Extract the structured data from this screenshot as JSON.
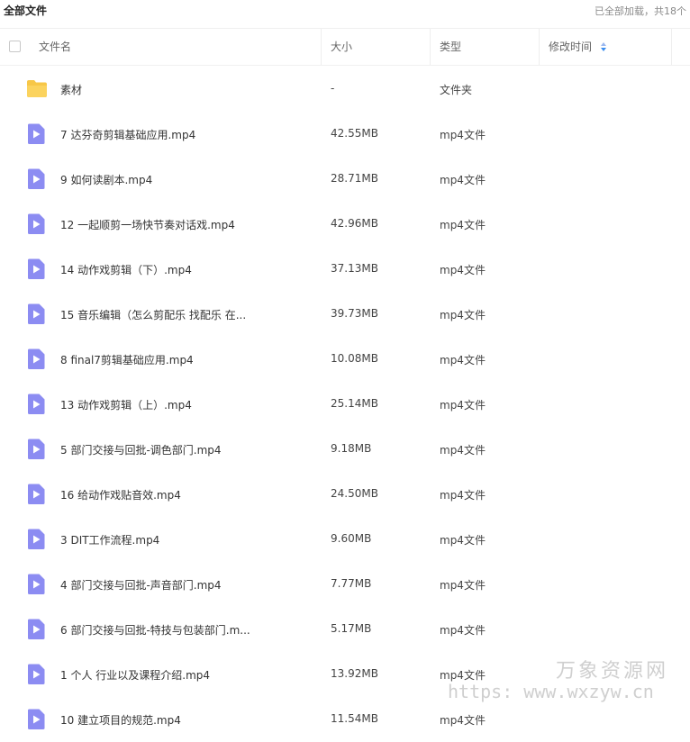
{
  "topbar": {
    "title": "全部文件",
    "status": "已全部加载，共18个"
  },
  "header": {
    "name_label": "文件名",
    "size_label": "大小",
    "type_label": "类型",
    "modified_label": "修改时间"
  },
  "files": [
    {
      "name": "素材",
      "size": "-",
      "type": "文件夹",
      "icon": "folder-icon"
    },
    {
      "name": "7 达芬奇剪辑基础应用.mp4",
      "size": "42.55MB",
      "type": "mp4文件",
      "icon": "video-file-icon"
    },
    {
      "name": "9 如何读剧本.mp4",
      "size": "28.71MB",
      "type": "mp4文件",
      "icon": "video-file-icon"
    },
    {
      "name": "12 一起顺剪一场快节奏对话戏.mp4",
      "size": "42.96MB",
      "type": "mp4文件",
      "icon": "video-file-icon"
    },
    {
      "name": "14 动作戏剪辑（下）.mp4",
      "size": "37.13MB",
      "type": "mp4文件",
      "icon": "video-file-icon"
    },
    {
      "name": "15 音乐编辑（怎么剪配乐 找配乐 在...",
      "size": "39.73MB",
      "type": "mp4文件",
      "icon": "video-file-icon"
    },
    {
      "name": "8 final7剪辑基础应用.mp4",
      "size": "10.08MB",
      "type": "mp4文件",
      "icon": "video-file-icon"
    },
    {
      "name": "13 动作戏剪辑（上）.mp4",
      "size": "25.14MB",
      "type": "mp4文件",
      "icon": "video-file-icon"
    },
    {
      "name": "5 部门交接与回批-调色部门.mp4",
      "size": "9.18MB",
      "type": "mp4文件",
      "icon": "video-file-icon"
    },
    {
      "name": "16 给动作戏贴音效.mp4",
      "size": "24.50MB",
      "type": "mp4文件",
      "icon": "video-file-icon"
    },
    {
      "name": "3 DIT工作流程.mp4",
      "size": "9.60MB",
      "type": "mp4文件",
      "icon": "video-file-icon"
    },
    {
      "name": "4 部门交接与回批-声音部门.mp4",
      "size": "7.77MB",
      "type": "mp4文件",
      "icon": "video-file-icon"
    },
    {
      "name": "6 部门交接与回批-特技与包装部门.m...",
      "size": "5.17MB",
      "type": "mp4文件",
      "icon": "video-file-icon"
    },
    {
      "name": "1 个人 行业以及课程介绍.mp4",
      "size": "13.92MB",
      "type": "mp4文件",
      "icon": "video-file-icon"
    },
    {
      "name": "10 建立项目的规范.mp4",
      "size": "11.54MB",
      "type": "mp4文件",
      "icon": "video-file-icon"
    }
  ],
  "watermark": {
    "line1": "万象资源网",
    "line2": "https: www.wxzyw.cn"
  },
  "colors": {
    "folder": "#f7c748",
    "video_icon": "#8c8cf2",
    "sort_up": "#9bb8f0",
    "sort_down": "#3a8ef0"
  }
}
